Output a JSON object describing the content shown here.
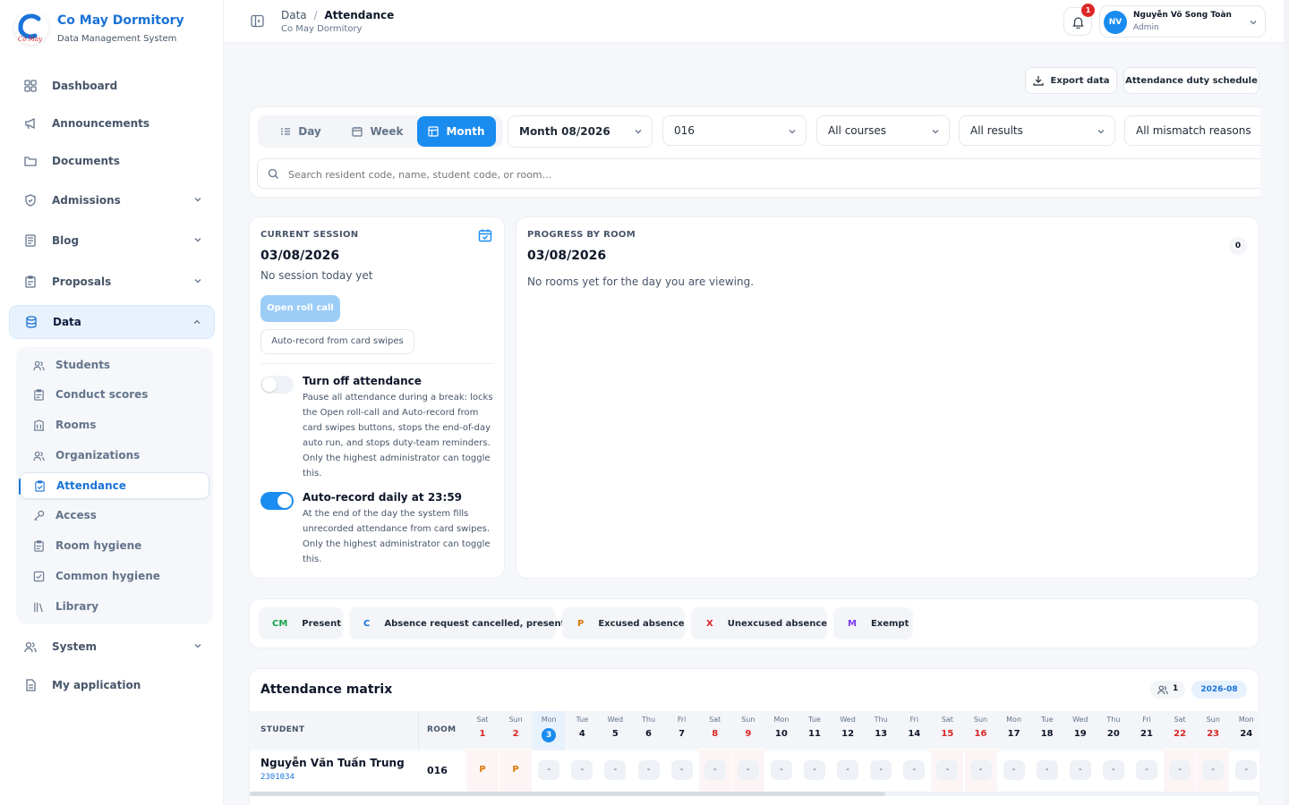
{
  "app": {
    "name": "Co May Dormitory",
    "subtitle": "Data Management System",
    "logo_text": "Cô May"
  },
  "sidebar": {
    "items": [
      {
        "label": "Dashboard",
        "icon": "dashboard-icon"
      },
      {
        "label": "Announcements",
        "icon": "megaphone-icon"
      },
      {
        "label": "Documents",
        "icon": "folder-icon"
      },
      {
        "label": "Admissions",
        "icon": "shield-icon"
      },
      {
        "label": "Blog",
        "icon": "newspaper-icon"
      },
      {
        "label": "Proposals",
        "icon": "clipboard-icon"
      },
      {
        "label": "Data",
        "icon": "database-icon"
      },
      {
        "label": "System",
        "icon": "users-icon"
      },
      {
        "label": "My application",
        "icon": "file-icon"
      }
    ],
    "data_sub": [
      {
        "label": "Students",
        "icon": "users-icon"
      },
      {
        "label": "Conduct scores",
        "icon": "clipboard-icon"
      },
      {
        "label": "Rooms",
        "icon": "building-icon"
      },
      {
        "label": "Organizations",
        "icon": "users-icon"
      },
      {
        "label": "Attendance",
        "icon": "clipboard-check-icon"
      },
      {
        "label": "Access",
        "icon": "key-icon"
      },
      {
        "label": "Room hygiene",
        "icon": "clipboard-icon"
      },
      {
        "label": "Common hygiene",
        "icon": "checkbox-icon"
      },
      {
        "label": "Library",
        "icon": "library-icon"
      }
    ]
  },
  "header": {
    "breadcrumb_root": "Data",
    "breadcrumb_sep": "/",
    "breadcrumb_current": "Attendance",
    "subtitle": "Co May Dormitory",
    "notification_count": "1",
    "user": {
      "initials": "NV",
      "name": "Nguyễn Võ Song Toàn",
      "role": "Admin"
    }
  },
  "actions": {
    "export": "Export data",
    "duty": "Attendance duty schedule"
  },
  "filters": {
    "tabs": {
      "day": "Day",
      "week": "Week",
      "month": "Month",
      "selected": "Month"
    },
    "month_value": "Month 08/2026",
    "room_value": "016",
    "courses_value": "All courses",
    "results_value": "All results",
    "reasons_value": "All mismatch reasons",
    "search_placeholder": "Search resident code, name, student code, or room..."
  },
  "session": {
    "label": "CURRENT SESSION",
    "date": "03/08/2026",
    "status": "No session today yet",
    "open_btn": "Open roll call",
    "auto_btn": "Auto-record from card swipes",
    "toggle1": {
      "title": "Turn off attendance",
      "desc": [
        "Pause all attendance during a break: locks",
        "the Open roll-call and Auto-record from",
        "card swipes buttons, stops the end-of-day",
        "auto run, and stops duty-team reminders.",
        "Only the highest administrator can toggle",
        "this."
      ],
      "on": false
    },
    "toggle2": {
      "title": "Auto-record daily at 23:59",
      "desc": [
        "At the end of the day the system fills",
        "unrecorded attendance from card swipes.",
        "Only the highest administrator can toggle",
        "this."
      ],
      "on": true
    }
  },
  "progress": {
    "label": "PROGRESS BY ROOM",
    "date": "03/08/2026",
    "count": "0",
    "empty": "No rooms yet for the day you are viewing."
  },
  "legend": [
    {
      "code": "CM",
      "label": "Present",
      "color": "#16a34a"
    },
    {
      "code": "C",
      "label": "Absence request cancelled, present",
      "color": "#1a73d8"
    },
    {
      "code": "P",
      "label": "Excused absence",
      "color": "#d97706"
    },
    {
      "code": "X",
      "label": "Unexcused absence",
      "color": "#dc2626"
    },
    {
      "code": "M",
      "label": "Exempt",
      "color": "#7c3aed"
    }
  ],
  "matrix": {
    "title": "Attendance matrix",
    "member_count": "1",
    "period": "2026-08",
    "col_student": "STUDENT",
    "col_room": "ROOM",
    "days": [
      {
        "wd": "Sat",
        "d": "1"
      },
      {
        "wd": "Sun",
        "d": "2"
      },
      {
        "wd": "Mon",
        "d": "3"
      },
      {
        "wd": "Tue",
        "d": "4"
      },
      {
        "wd": "Wed",
        "d": "5"
      },
      {
        "wd": "Thu",
        "d": "6"
      },
      {
        "wd": "Fri",
        "d": "7"
      },
      {
        "wd": "Sat",
        "d": "8"
      },
      {
        "wd": "Sun",
        "d": "9"
      },
      {
        "wd": "Mon",
        "d": "10"
      },
      {
        "wd": "Tue",
        "d": "11"
      },
      {
        "wd": "Wed",
        "d": "12"
      },
      {
        "wd": "Thu",
        "d": "13"
      },
      {
        "wd": "Fri",
        "d": "14"
      },
      {
        "wd": "Sat",
        "d": "15"
      },
      {
        "wd": "Sun",
        "d": "16"
      },
      {
        "wd": "Mon",
        "d": "17"
      },
      {
        "wd": "Tue",
        "d": "18"
      },
      {
        "wd": "Wed",
        "d": "19"
      },
      {
        "wd": "Thu",
        "d": "20"
      },
      {
        "wd": "Fri",
        "d": "21"
      },
      {
        "wd": "Sat",
        "d": "22"
      },
      {
        "wd": "Sun",
        "d": "23"
      },
      {
        "wd": "Mon",
        "d": "24"
      }
    ],
    "rows": [
      {
        "name": "Nguyễn Văn Tuấn Trung",
        "code": "2301034",
        "room": "016",
        "cells": [
          "P",
          "P",
          "-",
          "-",
          "-",
          "-",
          "-",
          "-",
          "-",
          "-",
          "-",
          "-",
          "-",
          "-",
          "-",
          "-",
          "-",
          "-",
          "-",
          "-",
          "-",
          "-",
          "-",
          "-"
        ]
      }
    ]
  }
}
